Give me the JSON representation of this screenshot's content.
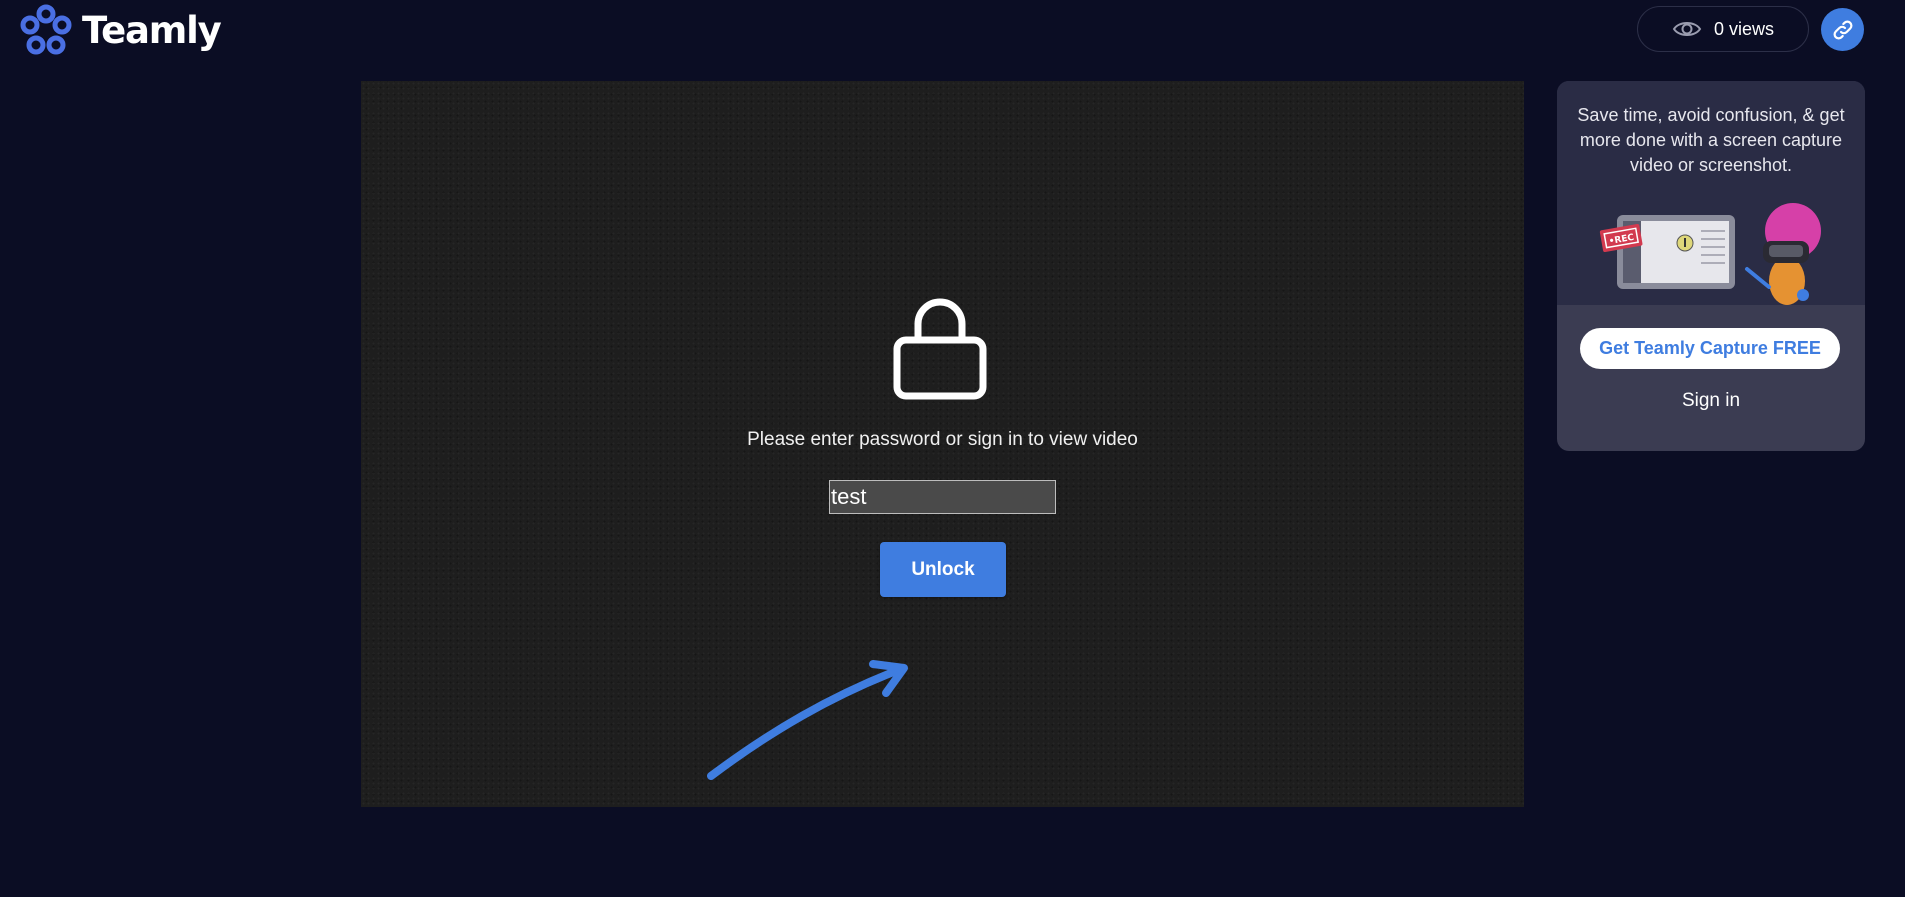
{
  "brand": {
    "name": "Teamly",
    "accent_color": "#3f7de0",
    "background_color": "#0b0d24"
  },
  "header": {
    "views_label": "0 views",
    "views_icon": "eye-icon",
    "link_icon": "link-icon"
  },
  "lock_screen": {
    "icon": "lock-icon",
    "message": "Please enter password or sign in to view video",
    "password_value": "test",
    "unlock_label": "Unlock",
    "annotation_icon": "arrow-annotation"
  },
  "promo": {
    "text": "Save time, avoid confusion, & get more done with a screen capture video or screenshot.",
    "illustration_badge": "•REC",
    "cta_label": "Get Teamly Capture FREE",
    "signin_label": "Sign in"
  }
}
